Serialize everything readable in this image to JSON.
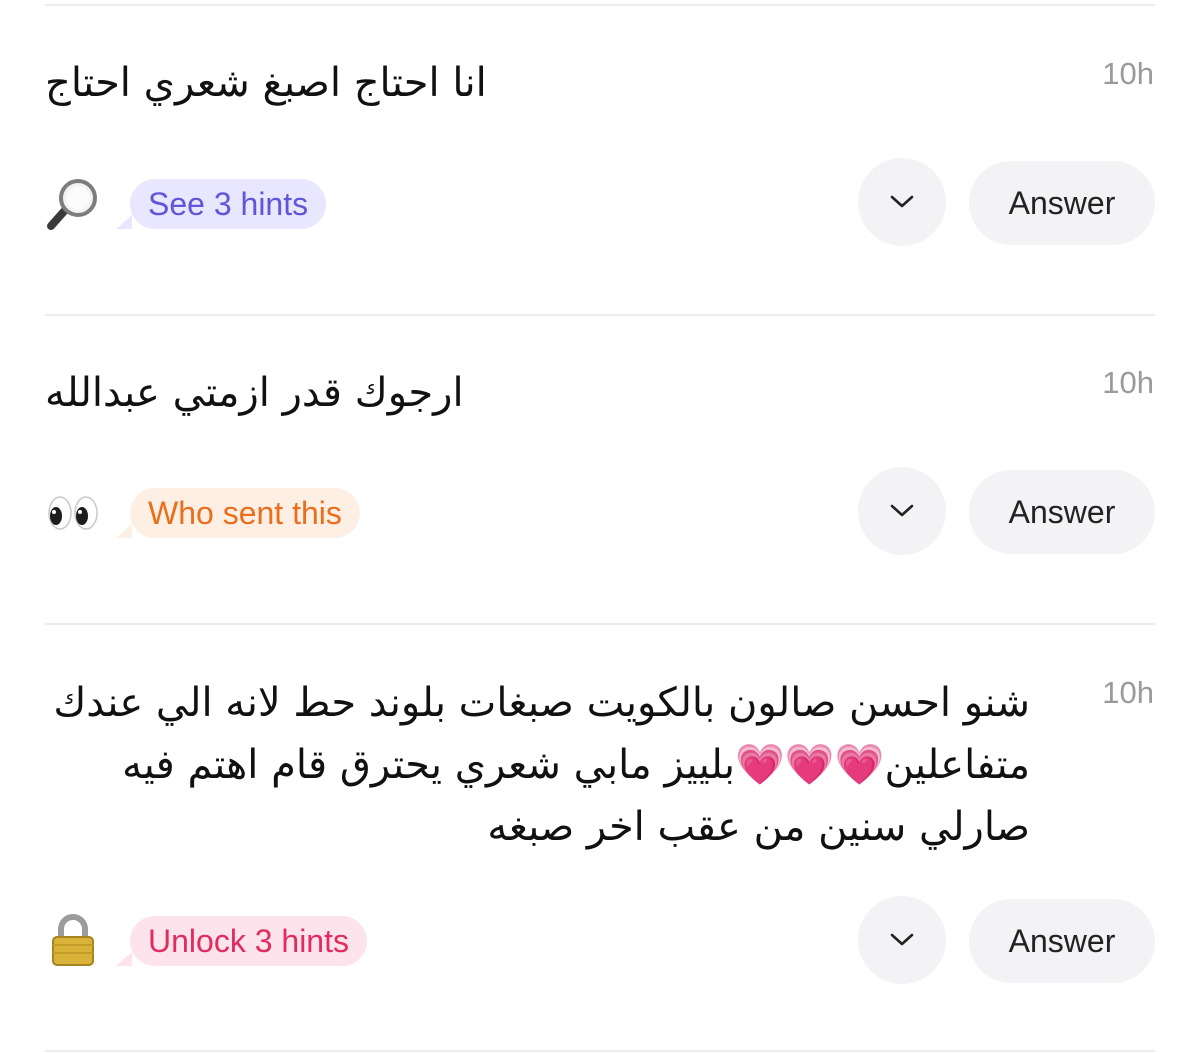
{
  "questions": [
    {
      "text": "انا احتاج اصبغ شعري احتاج",
      "time": "10h",
      "emoji": "magnifier",
      "hint_label": "See 3 hints",
      "hint_color": "#5f56d8",
      "answer_label": "Answer"
    },
    {
      "text": "ارجوك قدر ازمتي عبدالله",
      "time": "10h",
      "emoji": "eyes",
      "hint_label": "Who sent this",
      "hint_color": "#ea6e1c",
      "answer_label": "Answer"
    },
    {
      "text": "شنو احسن صالون بالكويت صبغات بلوند حط لانه الي عندك متفاعلين💗💗💗بلييز مابي شعري يحترق قام اهتم فيه صارلي سنين من عقب اخر صبغه",
      "time": "10h",
      "emoji": "lock",
      "hint_label": "Unlock 3 hints",
      "hint_color": "#e22c5f",
      "answer_label": "Answer"
    }
  ]
}
